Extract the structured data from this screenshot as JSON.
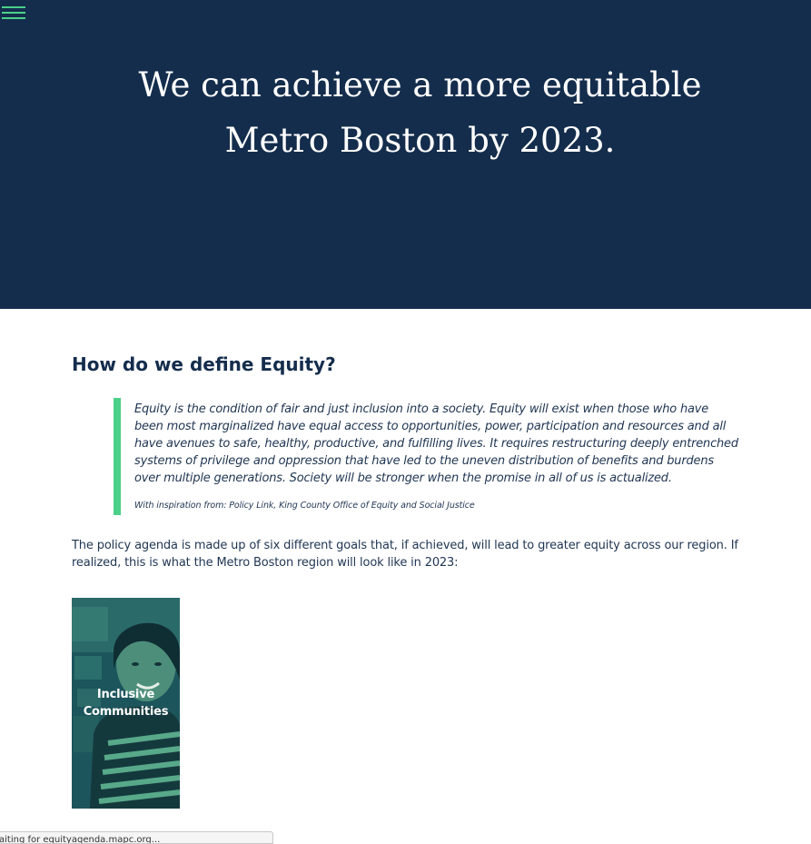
{
  "header": {
    "menu_icon": "hamburger-menu-icon",
    "hero_title_line1": "We can achieve a more equitable",
    "hero_title_line2": "Metro Boston by 2023."
  },
  "equity": {
    "heading": "How do we define Equity?",
    "quote": "Equity is the condition of fair and just inclusion into a society. Equity will exist when those who have been most marginalized have equal access to opportunities, power, participation and resources and all have avenues to safe, healthy, productive, and fulfilling lives. It requires restructuring deeply entrenched systems of privilege and oppression that have led to the uneven distribution of benefits and burdens over multiple generations. Society will be stronger when the promise in all of us is actualized.",
    "quote_source": "With inspiration from: Policy Link, King County Office of Equity and Social Justice"
  },
  "intro": "The policy agenda is made up of six different goals that, if achieved, will lead to greater equity across our region. If realized, this is what the Metro Boston region will look like in 2023:",
  "goals": [
    {
      "label_line1": "Inclusive",
      "label_line2": "Communities"
    }
  ],
  "status_bar": {
    "text": "aiting for equityagenda.mapc.org..."
  },
  "colors": {
    "hero_bg": "#142d4c",
    "accent_green": "#4bd089",
    "text_dark": "#1f3552",
    "card_tint": "#1e5a60"
  }
}
